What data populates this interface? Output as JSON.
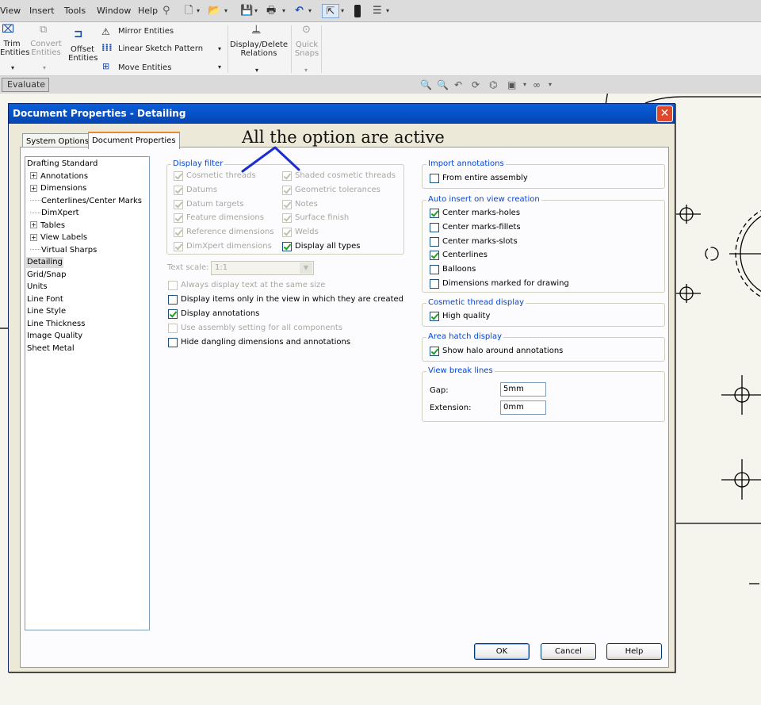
{
  "menu": {
    "items": [
      "View",
      "Insert",
      "Tools",
      "Window",
      "Help"
    ]
  },
  "ribbon": {
    "trim_label": "Trim\nEntities",
    "convert_label": "Convert\nEntities",
    "offset_label": "Offset\nEntities",
    "mirror_label": "Mirror Entities",
    "linear_pattern_label": "Linear Sketch Pattern",
    "move_label": "Move Entities",
    "display_delete_label": "Display/Delete\nRelations",
    "quick_snaps_label": "Quick\nSnaps"
  },
  "tabstrip": {
    "evaluate_label": "Evaluate"
  },
  "dialog": {
    "title": "Document Properties - Detailing",
    "close_glyph": "✕",
    "tabs": [
      "System Options",
      "Document Properties"
    ],
    "tree": [
      {
        "label": "Drafting Standard",
        "indent": 0,
        "type": "root"
      },
      {
        "label": "Annotations",
        "indent": 1,
        "type": "expand"
      },
      {
        "label": "Dimensions",
        "indent": 1,
        "type": "expand"
      },
      {
        "label": "Centerlines/Center Marks",
        "indent": 1,
        "type": "leaf"
      },
      {
        "label": "DimXpert",
        "indent": 1,
        "type": "leaf"
      },
      {
        "label": "Tables",
        "indent": 1,
        "type": "expand"
      },
      {
        "label": "View Labels",
        "indent": 1,
        "type": "expand"
      },
      {
        "label": "Virtual Sharps",
        "indent": 1,
        "type": "leaf"
      },
      {
        "label": "Detailing",
        "indent": 0,
        "type": "root",
        "selected": true
      },
      {
        "label": "Grid/Snap",
        "indent": 0,
        "type": "root"
      },
      {
        "label": "Units",
        "indent": 0,
        "type": "root"
      },
      {
        "label": "Line Font",
        "indent": 0,
        "type": "root"
      },
      {
        "label": "Line Style",
        "indent": 0,
        "type": "root"
      },
      {
        "label": "Line Thickness",
        "indent": 0,
        "type": "root"
      },
      {
        "label": "Image Quality",
        "indent": 0,
        "type": "root"
      },
      {
        "label": "Sheet Metal",
        "indent": 0,
        "type": "root"
      }
    ],
    "display_filter": {
      "title": "Display filter",
      "left": [
        {
          "label": "Cosmetic threads",
          "checked": true,
          "disabled": true
        },
        {
          "label": "Datums",
          "checked": true,
          "disabled": true
        },
        {
          "label": "Datum targets",
          "checked": true,
          "disabled": true
        },
        {
          "label": "Feature dimensions",
          "checked": true,
          "disabled": true
        },
        {
          "label": "Reference dimensions",
          "checked": true,
          "disabled": true
        },
        {
          "label": "DimXpert dimensions",
          "checked": true,
          "disabled": true
        }
      ],
      "right": [
        {
          "label": "Shaded cosmetic threads",
          "checked": true,
          "disabled": true
        },
        {
          "label": "Geometric tolerances",
          "checked": true,
          "disabled": true
        },
        {
          "label": "Notes",
          "checked": true,
          "disabled": true
        },
        {
          "label": "Surface finish",
          "checked": true,
          "disabled": true
        },
        {
          "label": "Welds",
          "checked": true,
          "disabled": true
        },
        {
          "label": "Display all types",
          "checked": true,
          "disabled": false
        }
      ]
    },
    "text_scale_label": "Text scale:",
    "text_scale_value": "1:1",
    "options": [
      {
        "label": "Always display text at the same size",
        "checked": false,
        "disabled": true
      },
      {
        "label": "Display items only in the view in which they are created",
        "checked": false,
        "disabled": false
      },
      {
        "label": "Display annotations",
        "checked": true,
        "disabled": false
      },
      {
        "label": "Use assembly setting for all components",
        "checked": false,
        "disabled": true
      },
      {
        "label": "Hide dangling dimensions and annotations",
        "checked": false,
        "disabled": false
      }
    ],
    "import_annotations": {
      "title": "Import annotations",
      "items": [
        {
          "label": "From entire assembly",
          "checked": false
        }
      ]
    },
    "auto_insert": {
      "title": "Auto insert on view creation",
      "items": [
        {
          "label": "Center marks-holes",
          "checked": true
        },
        {
          "label": "Center marks-fillets",
          "checked": false
        },
        {
          "label": "Center marks-slots",
          "checked": false
        },
        {
          "label": "Centerlines",
          "checked": true
        },
        {
          "label": "Balloons",
          "checked": false
        },
        {
          "label": "Dimensions marked for drawing",
          "checked": false
        }
      ]
    },
    "cosmetic_thread": {
      "title": "Cosmetic thread display",
      "items": [
        {
          "label": "High quality",
          "checked": true
        }
      ]
    },
    "area_hatch": {
      "title": "Area hatch display",
      "items": [
        {
          "label": "Show halo around annotations",
          "checked": true
        }
      ]
    },
    "view_break": {
      "title": "View break lines",
      "gap_label": "Gap:",
      "gap_value": "5mm",
      "extension_label": "Extension:",
      "extension_value": "0mm"
    },
    "buttons": {
      "ok": "OK",
      "cancel": "Cancel",
      "help": "Help"
    }
  },
  "annotation": {
    "text": "All the option are active",
    "color": "#1a2ed0"
  }
}
